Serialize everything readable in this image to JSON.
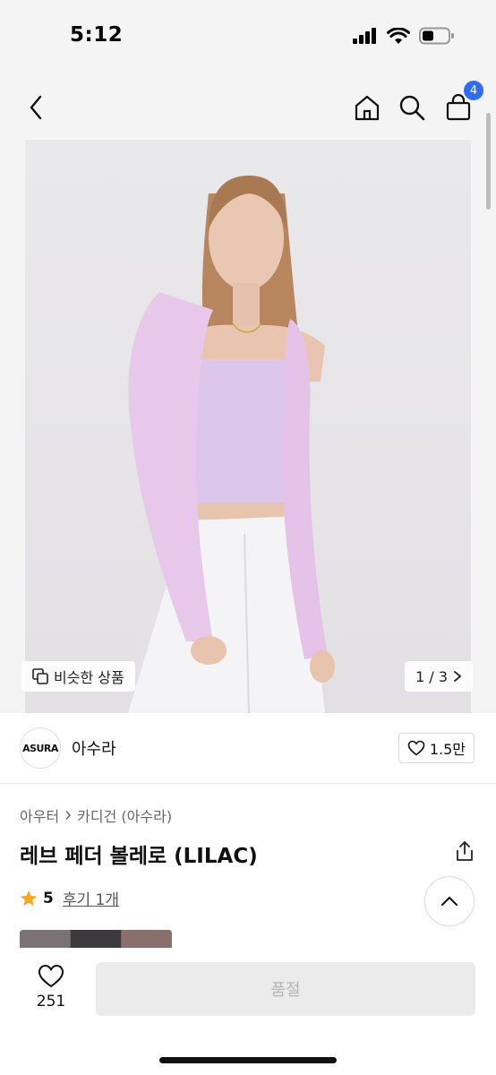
{
  "status": {
    "time": "5:12"
  },
  "header": {
    "cart_count": "4"
  },
  "hero": {
    "similar_label": "비슷한 상품",
    "pager_text": "1 / 3"
  },
  "brand": {
    "logo_text": "ASURA",
    "name": "아수라",
    "likes": "1.5만"
  },
  "product": {
    "category_parent": "아우터",
    "category_child": "카디건 (아수라)",
    "title": "레브 페더 볼레로 (LILAC)",
    "rating": "5",
    "review_text": "후기 1개"
  },
  "bottom": {
    "wish_count": "251",
    "buy_label": "품절"
  },
  "colors": {
    "badge": "#2f6df6",
    "star": "#f5a623",
    "soldout_bg": "#ebebeb",
    "cardigan": "#e8c8ea",
    "top": "#dcc6ea"
  },
  "icons": [
    "back-icon",
    "home-icon",
    "search-icon",
    "cart-icon",
    "copy-icon",
    "chevron-right-icon",
    "heart-icon",
    "share-icon",
    "star-icon",
    "chevron-up-icon"
  ]
}
